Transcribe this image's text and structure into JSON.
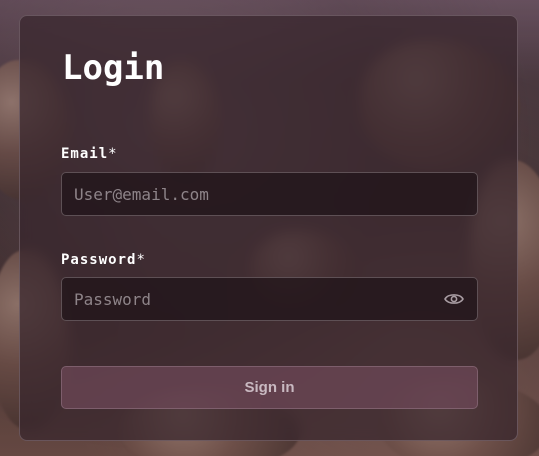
{
  "login": {
    "title": "Login",
    "email": {
      "label": "Email",
      "required_mark": "*",
      "value": "",
      "placeholder": "User@email.com"
    },
    "password": {
      "label": "Password",
      "required_mark": "*",
      "value": "",
      "placeholder": "Password",
      "toggle_icon": "eye-icon"
    },
    "submit_label": "Sign in"
  },
  "colors": {
    "card_background": "#37262c",
    "button_background": "#6e4858",
    "text_primary": "#ffffff",
    "placeholder": "#8e8489"
  }
}
